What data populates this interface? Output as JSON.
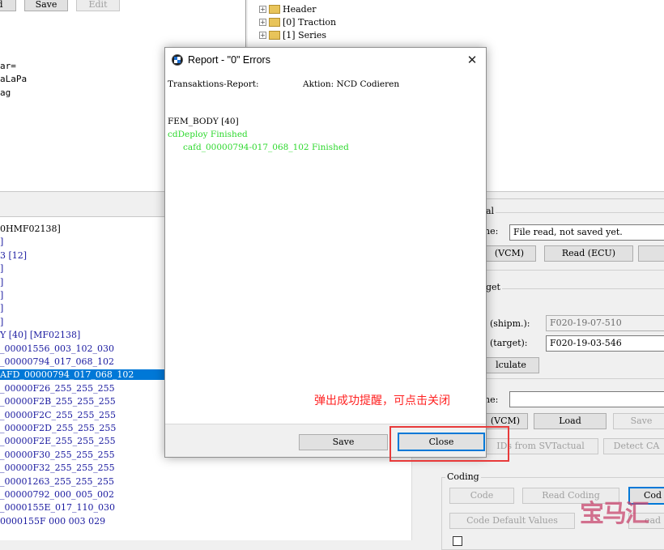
{
  "top_left": {
    "buttons": [
      "d",
      "Save",
      "Edit"
    ],
    "text_lines": [
      "ar=",
      "aLaPa",
      "ag"
    ]
  },
  "top_tree": {
    "items": [
      "Header",
      "[0] Traction",
      "[1] Series"
    ]
  },
  "left_tree": {
    "lines": [
      "0HMF02138]",
      "]",
      "3 [12]",
      "]",
      "]",
      "]",
      "]",
      "]",
      "Y [40] [MF02138]",
      "_00001556_003_102_030",
      "_00000794_017_068_102",
      "AFD_00000794_017_068_102",
      "_00000F26_255_255_255",
      "_00000F2B_255_255_255",
      "_00000F2C_255_255_255",
      "_00000F2D_255_255_255",
      "_00000F2E_255_255_255",
      "_00000F30_255_255_255",
      "_00000F32_255_255_255",
      "_00001263_255_255_255",
      "_00000792_000_005_002",
      "_0000155E_017_110_030",
      "0000155F 000 003 029"
    ],
    "selected_index": 11
  },
  "right_panel": {
    "actual_title": "al",
    "file_label": "ne:",
    "file_value": "File read, not saved yet.",
    "btn_vcm": "(VCM)",
    "btn_read_ecu": "Read (ECU)",
    "target_title": "get",
    "shipm_label": "(shipm.):",
    "shipm_value": "F020-19-07-510",
    "target_label": "(target):",
    "target_value": "F020-19-03-546",
    "btn_calculate": "lculate",
    "file2_label": "ne:",
    "file2_value": "",
    "btn_vcm2": "(VCM)",
    "btn_load": "Load",
    "btn_save": "Save",
    "btn_ids": "IDs from SVTactual",
    "btn_detect": "Detect CA",
    "coding_title": "Coding",
    "btn_code": "Code",
    "btn_read_coding": "Read Coding",
    "btn_cod": "Cod",
    "btn_code_default": "Code Default Values",
    "btn_read2": "ead"
  },
  "dialog": {
    "title": "Report - \"0\" Errors",
    "line1_left": "Transaktions-Report:",
    "line1_right": "Aktion: NCD Codieren",
    "ecu": "FEM_BODY [40]",
    "status": "cdDeploy Finished",
    "cafd": "cafd_00000794-017_068_102 Finished",
    "btn_save": "Save",
    "btn_close": "Close"
  },
  "annotation": "弹出成功提醒，可点击关闭",
  "watermark": "宝马汇"
}
